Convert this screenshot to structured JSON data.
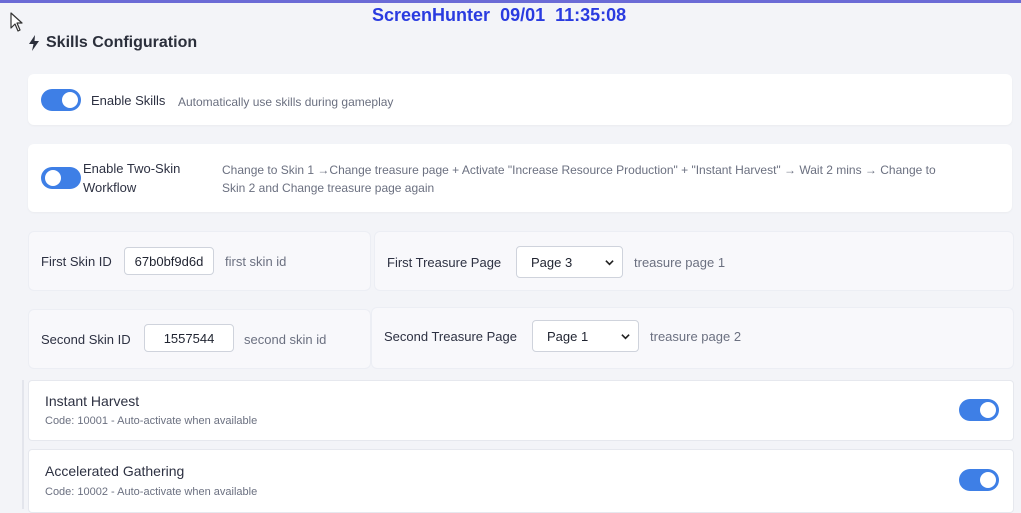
{
  "watermark": {
    "app": "ScreenHunter",
    "date": "09/01",
    "time": "11:35:08"
  },
  "section": {
    "icon": "bolt-icon",
    "title": "Skills Configuration"
  },
  "enable_skills": {
    "label": "Enable Skills",
    "description": "Automatically use skills during gameplay",
    "enabled": true
  },
  "two_skin": {
    "label_line1": "Enable Two-Skin",
    "label_line2": "Workflow",
    "description_line1": "Change to Skin 1 →Change treasure page + Activate \"Increase Resource Production\" + \"Instant Harvest\" → Wait 2 mins → Change to",
    "description_line2": "Skin 2 and Change treasure page again",
    "enabled": true
  },
  "first_skin": {
    "label": "First Skin ID",
    "value": "67b0bf9d6d",
    "hint": "first skin id"
  },
  "first_treasure": {
    "label": "First Treasure Page",
    "selected": "Page 3",
    "hint": "treasure page 1"
  },
  "second_skin": {
    "label": "Second Skin ID",
    "value": "1557544",
    "hint": "second skin id"
  },
  "second_treasure": {
    "label": "Second Treasure Page",
    "selected": "Page 1",
    "hint": "treasure page 2"
  },
  "skills": [
    {
      "name": "Instant Harvest",
      "code": "Code: 10001 - Auto-activate when available",
      "enabled": true
    },
    {
      "name": "Accelerated Gathering",
      "code": "Code: 10002 - Auto-activate when available",
      "enabled": true
    }
  ],
  "colors": {
    "accent": "#3e7fe6",
    "watermark": "#2a3be0",
    "background": "#f3f4f8"
  }
}
